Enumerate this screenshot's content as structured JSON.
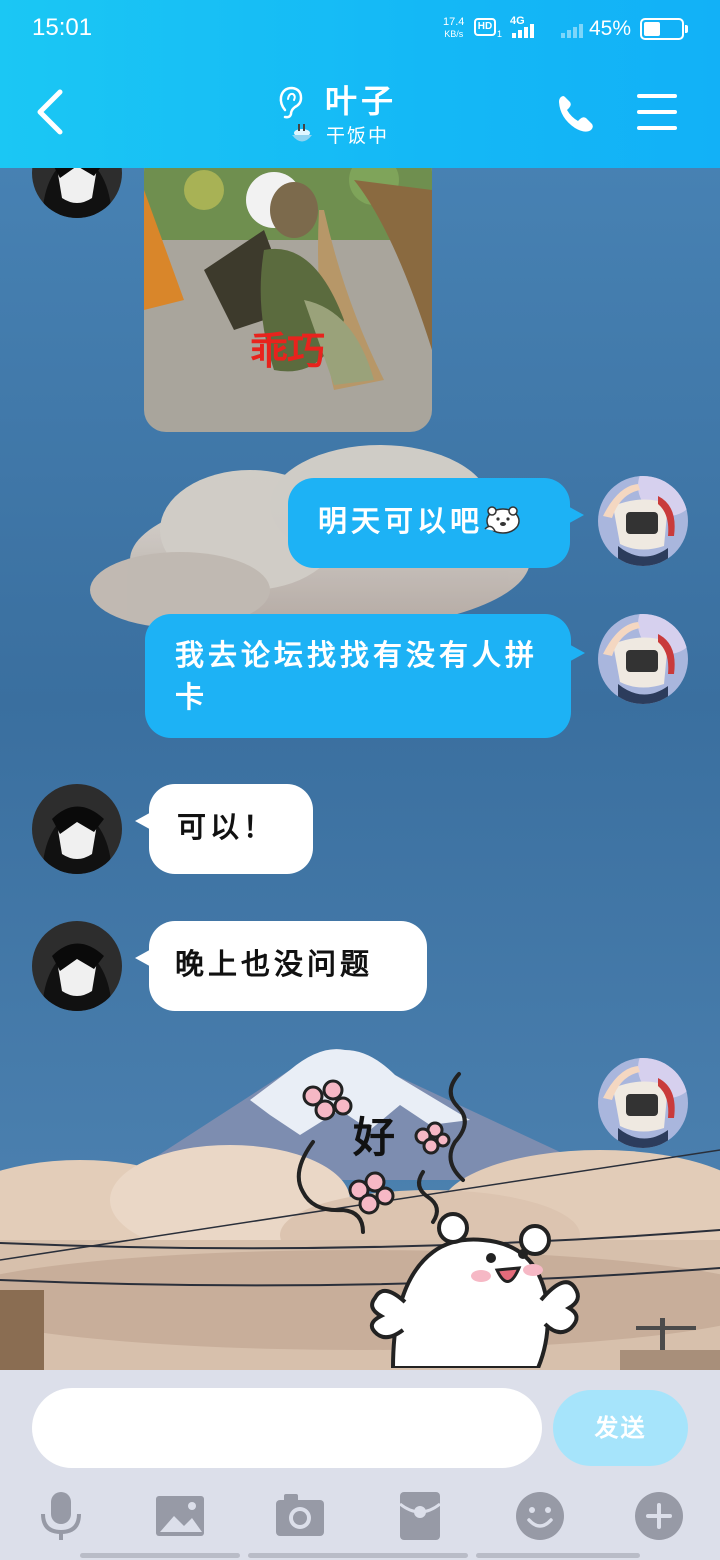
{
  "status_bar": {
    "time": "15:01",
    "net_speed_value": "17.4",
    "net_speed_unit": "KB/s",
    "hd_label": "HD",
    "hd_sub": "1",
    "network": "4G",
    "battery_text": "45%",
    "battery_level": 0.45
  },
  "header": {
    "contact_name": "叶子",
    "contact_status": "干饭中",
    "back_icon": "chevron-left-icon",
    "ear_icon": "ear-icon",
    "status_icon": "rice-bowl-icon",
    "call_icon": "phone-icon",
    "menu_icon": "hamburger-menu-icon"
  },
  "messages": [
    {
      "side": "in",
      "type": "image",
      "caption": "乖巧"
    },
    {
      "side": "out",
      "type": "text",
      "text": "明天可以吧",
      "emoji": "polar-bear-emoji"
    },
    {
      "side": "out",
      "type": "text",
      "text": "我去论坛找找有没有人拼卡"
    },
    {
      "side": "in",
      "type": "text",
      "text": "可以！"
    },
    {
      "side": "in",
      "type": "text",
      "text": "晚上也没问题"
    },
    {
      "side": "out",
      "type": "sticker",
      "text": "好"
    }
  ],
  "input": {
    "placeholder": "",
    "value": "",
    "send_label": "发送"
  },
  "toolbar": [
    "microphone-icon",
    "image-icon",
    "camera-icon",
    "red-packet-icon",
    "emoji-icon",
    "plus-icon"
  ],
  "colors": {
    "header": "#12b1f7",
    "bubble_out": "#1db2f5",
    "bubble_in": "#ffffff",
    "send_button": "#a6e4fb",
    "input_bar": "#dcdfea"
  }
}
